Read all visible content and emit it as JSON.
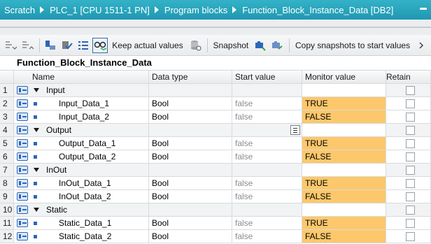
{
  "breadcrumb": [
    "Scratch",
    "PLC_1 [CPU 1511-1 PN]",
    "Program blocks",
    "Function_Block_Instance_Data [DB2]"
  ],
  "toolbar": {
    "keep_actual_values": "Keep actual values",
    "snapshot": "Snapshot",
    "copy_snapshots": "Copy snapshots to start values"
  },
  "db_title": "Function_Block_Instance_Data",
  "columns": {
    "name": "Name",
    "data_type": "Data type",
    "start_value": "Start value",
    "monitor_value": "Monitor value",
    "retain": "Retain"
  },
  "rows": [
    {
      "num": "1",
      "name": "Input",
      "section": true
    },
    {
      "num": "2",
      "name": "Input_Data_1",
      "type": "Bool",
      "start": "false",
      "monitor": "TRUE"
    },
    {
      "num": "3",
      "name": "Input_Data_2",
      "type": "Bool",
      "start": "false",
      "monitor": "FALSE"
    },
    {
      "num": "4",
      "name": "Output",
      "section": true
    },
    {
      "num": "5",
      "name": "Output_Data_1",
      "type": "Bool",
      "start": "false",
      "monitor": "TRUE"
    },
    {
      "num": "6",
      "name": "Output_Data_2",
      "type": "Bool",
      "start": "false",
      "monitor": "FALSE"
    },
    {
      "num": "7",
      "name": "InOut",
      "section": true
    },
    {
      "num": "8",
      "name": "InOut_Data_1",
      "type": "Bool",
      "start": "false",
      "monitor": "TRUE"
    },
    {
      "num": "9",
      "name": "InOut_Data_2",
      "type": "Bool",
      "start": "false",
      "monitor": "FALSE"
    },
    {
      "num": "10",
      "name": "Static",
      "section": true
    },
    {
      "num": "11",
      "name": "Static_Data_1",
      "type": "Bool",
      "start": "false",
      "monitor": "TRUE"
    },
    {
      "num": "12",
      "name": "Static_Data_2",
      "type": "Bool",
      "start": "false",
      "monitor": "FALSE"
    }
  ],
  "colors": {
    "breadcrumb_bg": "#1f98b1",
    "monitor_highlight": "#fdc86b",
    "icon_blue": "#2c66b8"
  },
  "icons": [
    "expand-all-icon",
    "collapse-all-icon",
    "insert-row-icon",
    "insert-row-below-icon",
    "columns-icon",
    "monitor-glasses-icon",
    "keep-values-icon",
    "snapshot-icon",
    "copy-snapshot-icon",
    "copy-snapshot-to-start-icon",
    "toolbar-overflow-icon"
  ]
}
